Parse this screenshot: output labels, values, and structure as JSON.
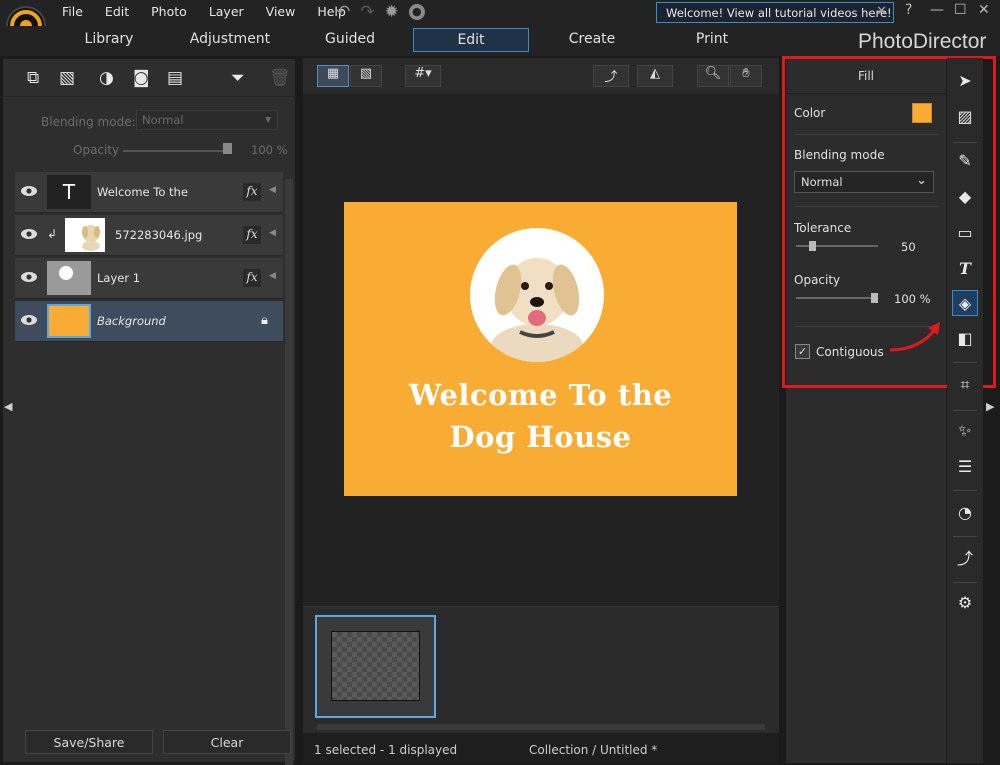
{
  "menu": [
    "File",
    "Edit",
    "Photo",
    "Layer",
    "View",
    "Help"
  ],
  "notice": "Welcome! View all tutorial videos here!",
  "help_label": "?",
  "modes": [
    "Library",
    "Adjustment",
    "Guided",
    "Edit",
    "Create",
    "Print"
  ],
  "active_mode": "Edit",
  "brand": "PhotoDirector",
  "left": {
    "blending_label": "Blending mode:",
    "blending_value": "Normal",
    "opacity_label": "Opacity",
    "opacity_value": "100 %",
    "opacity_level": 1.0,
    "layers": [
      {
        "name": "Welcome To the",
        "thumb": "T"
      },
      {
        "name": "572283046.jpg",
        "thumb": ""
      },
      {
        "name": "Layer 1",
        "thumb": ""
      },
      {
        "name": "Background",
        "thumb": ""
      }
    ],
    "fx_label": "fx",
    "save_share": "Save/Share",
    "clear": "Clear"
  },
  "canvas": {
    "poster_line1": "Welcome To the",
    "poster_line2": "Dog House",
    "poster_color": "#f9ac34"
  },
  "status": {
    "selected": "1 selected - 1 displayed",
    "collection": "Collection / Untitled *"
  },
  "fill_panel": {
    "title": "Fill",
    "color_label": "Color",
    "color_value": "#f9ac34",
    "blending_label": "Blending mode",
    "blending_value": "Normal",
    "tolerance_label": "Tolerance",
    "tolerance_value": "50",
    "tolerance_level": 0.2,
    "opacity_label": "Opacity",
    "opacity_value": "100 %",
    "opacity_level": 1.0,
    "contiguous_label": "Contiguous",
    "contiguous_checked": true
  },
  "highlight_color": "#e0191e"
}
